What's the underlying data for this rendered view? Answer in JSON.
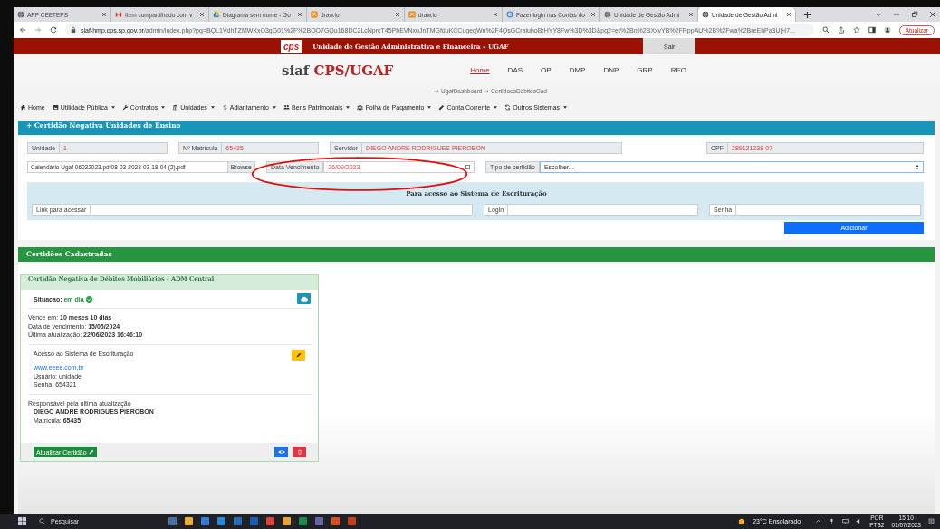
{
  "browser": {
    "tabs": [
      {
        "title": "APP CEETEPS",
        "kind": "globe",
        "selected": false
      },
      {
        "title": "Item compartilhado com v",
        "kind": "mail",
        "selected": false
      },
      {
        "title": "Diagrama sem nome - Go",
        "kind": "drive",
        "selected": false
      },
      {
        "title": "draw.io",
        "kind": "drawio",
        "selected": false
      },
      {
        "title": "draw.io",
        "kind": "drawio",
        "selected": false
      },
      {
        "title": "Fazer login nas Contas do",
        "kind": "google",
        "selected": false
      },
      {
        "title": "Unidade de Gestão Admi",
        "kind": "globe",
        "selected": false
      },
      {
        "title": "Unidade de Gestão Admi",
        "kind": "globe",
        "selected": true
      }
    ],
    "url_host": "siaf-hmp.cps.sp.gov.br",
    "url_path": "/admin/index.php?pg=BQL1VdhTZMWXxO3gG01%2F%2BOO7GQu168DC2LcNprcT45PbEVNxuJnTMGfduKCCugeqWn%2F4QsGCraiuhoBrHYY8Fw%3D%3D&pg2=et%2Bn%2BXxvYB%2FRppAU%2B%2Fwa%2BreEhPa3UjH7...",
    "update_button": "Atualizar"
  },
  "top_bar": {
    "logo": "cps",
    "title": "Unidade de Gestão Administrativa e Financeira – UGAF",
    "logout": "Sair"
  },
  "brand": {
    "prefix": "siaf",
    "name": "CPS/UGAF"
  },
  "nav": [
    {
      "label": "Home",
      "selected": true
    },
    {
      "label": "DAS",
      "selected": false
    },
    {
      "label": "OP",
      "selected": false
    },
    {
      "label": "DMP",
      "selected": false
    },
    {
      "label": "DNP",
      "selected": false
    },
    {
      "label": "GRP",
      "selected": false
    },
    {
      "label": "REO",
      "selected": false
    }
  ],
  "breadcrumb": "⇒ UgafDashboard ⇒ CertidoesDebitosCad",
  "menu": [
    {
      "label": "Home",
      "kind": "home",
      "dropdown": false
    },
    {
      "label": "Utilidade Pública",
      "kind": "image",
      "dropdown": true
    },
    {
      "label": "Contratos",
      "kind": "wrench",
      "dropdown": true
    },
    {
      "label": "Unidades",
      "kind": "columns",
      "dropdown": true
    },
    {
      "label": "Adiantamento",
      "kind": "dollar",
      "dropdown": true
    },
    {
      "label": "Bens Patrimoniais",
      "kind": "people",
      "dropdown": true
    },
    {
      "label": "Folha de Pagamento",
      "kind": "users",
      "dropdown": true
    },
    {
      "label": "Conta Corrente",
      "kind": "pencil",
      "dropdown": true
    },
    {
      "label": "Outros Sistemas",
      "kind": "refresh",
      "dropdown": true
    }
  ],
  "form": {
    "title": "+ Certidão Negativa Unidades de Ensino",
    "row1": [
      {
        "label": "Unidade",
        "value": "1"
      },
      {
        "label": "Nº Matrícula",
        "value": "65435"
      },
      {
        "label": "Servidor",
        "value": "DIEGO ANDRE RODRIGUES PIEROBON"
      },
      {
        "label": "CPF",
        "value": "289121238-07"
      }
    ],
    "file": {
      "value": "Calendário Ugaf 06032023.pdf08-03-2023-03-18-04 (2).pdf",
      "button": "Browse"
    },
    "due_date": {
      "label": "Data Vencimento",
      "value": "26/09/2023"
    },
    "type": {
      "label": "Tipo de certidão",
      "value": "Escolher..."
    },
    "access": {
      "title": "Para acesso ao Sistema de Escrituração",
      "fields": [
        {
          "label": "Link para acessar"
        },
        {
          "label": "Login"
        },
        {
          "label": "Senha"
        }
      ]
    },
    "submit": "Adicionar"
  },
  "list": {
    "title": "Certidões Cadastradas",
    "cards": [
      {
        "title": "Certidão Negativa de Débitos Mobiliários - ADM Central",
        "status_label": "Situacao:",
        "status": "em dia",
        "info": [
          "Vence em: **10 meses 10 dias**",
          "Data de vencimento: **15/05/2024**",
          "Última atualização: **22/06/2023 16:46:10**"
        ],
        "access_title": "Acesso ao Sistema de Escrituração",
        "link": "www.eeee.com.br",
        "user": "Usuário: unidade",
        "password": "Senha: 654321",
        "responsible_label": "Responsável pela última atualização",
        "responsible": "DIEGO ANDRE RODRIGUES PIEROBON",
        "registration": "Matrícula: **65435**",
        "update_button": "Atualizar Certidão"
      }
    ]
  },
  "taskbar": {
    "search": "Pesquisar",
    "weather": "23°C Ensolarado",
    "lang": "POR",
    "lang_sub": "PTB2",
    "time": "15:10",
    "date": "01/07/2023"
  }
}
